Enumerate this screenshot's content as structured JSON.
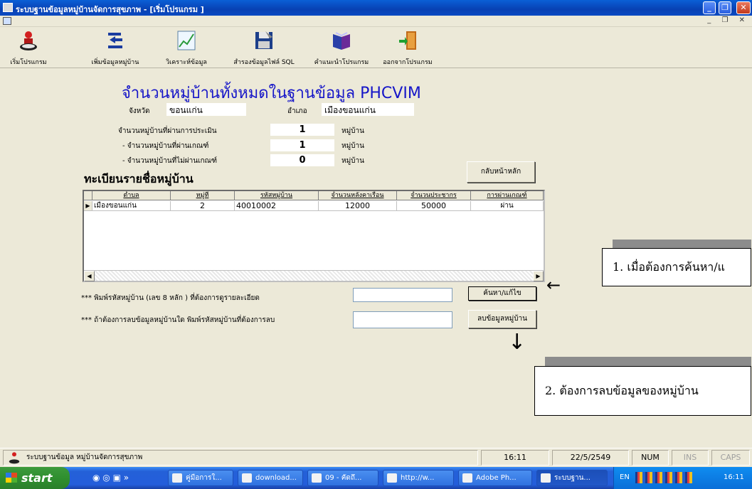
{
  "window": {
    "title": "ระบบฐานข้อมูลหมู่บ้านจัดการสุขภาพ - [เริ่มโปรแกรม ]",
    "min": "_",
    "max": "❐",
    "close": "✕",
    "mdi_controls": "_ ❐ ✕"
  },
  "toolbar": {
    "items": [
      {
        "label": "เริ่มโปรแกรม",
        "icon": "person-icon"
      },
      {
        "label": "เพิ่มข้อมูลหมู่บ้าน",
        "icon": "arrows-icon"
      },
      {
        "label": "วิเคราะห์ข้อมูล",
        "icon": "chart-icon"
      },
      {
        "label": "สำรองข้อมูลไฟล์ SQL",
        "icon": "floppy-icon"
      },
      {
        "label": "คำแนะนำโปรแกรม",
        "icon": "book-icon"
      },
      {
        "label": "ออกจากโปรแกรม",
        "icon": "exit-door-icon"
      }
    ]
  },
  "main": {
    "heading": "จำนวนหมู่บ้านทั้งหมดในฐานข้อมูล  PHCVIM",
    "province_label": "จังหวัด",
    "province_value": "ขอนแก่น",
    "district_label": "อำเภอ",
    "district_value": "เมืองขอนแก่น",
    "counts": [
      {
        "label": "จำนวนหมู่บ้านที่ผ่านการประเมิน",
        "value": "1",
        "unit": "หมู่บ้าน"
      },
      {
        "label": "- จำนวนหมู่บ้านที่ผ่านเกณฑ์",
        "value": "1",
        "unit": "หมู่บ้าน"
      },
      {
        "label": "- จำนวนหมู่บ้านที่ไม่ผ่านเกณฑ์",
        "value": "0",
        "unit": "หมู่บ้าน"
      }
    ],
    "back_button": "กลับหน้าหลัก",
    "register_heading": "ทะเบียนรายชื่อหมู่บ้าน",
    "grid": {
      "headers": [
        "ตำบล",
        "หมู่ที่",
        "รหัสหมู่บ้าน",
        "จำนวนหลังคาเรือน",
        "จำนวนประชากร",
        "การผ่านเกณฑ์"
      ],
      "rows": [
        [
          "เมืองขอนแก่น",
          "2",
          "40010002",
          "12000",
          "50000",
          "ผ่าน"
        ]
      ],
      "row_indicator": "▶",
      "scroll_left": "◀",
      "scroll_right": "▶"
    },
    "search_prompt": "*** พิมพ์รหัสหมู่บ้าน (เลข 8 หลัก ) ที่ต้องการดูรายละเอียด",
    "search_input": "",
    "search_button": "ค้นหา/แก้ไข",
    "delete_prompt": "*** ถ้าต้องการลบข้อมูลหมู่บ้านใด พิมพ์รหัสหมู่บ้านที่ต้องการลบ",
    "delete_input": "",
    "delete_button": "ลบข้อมูลหมู่บ้าน"
  },
  "annotations": {
    "callout1": "1. เมื่อต้องการค้นหา/แ",
    "callout2": "2.  ต้องการลบข้อมูลของหมู่บ้าน",
    "arrow_left": "←",
    "arrow_down": "↓"
  },
  "statusbar": {
    "app_name": "ระบบฐานข้อมูล หมู่บ้านจัดการสุขภาพ",
    "time": "16:11",
    "date": "22/5/2549",
    "num": "NUM",
    "ins": "INS",
    "caps": "CAPS"
  },
  "taskbar": {
    "start": "start",
    "items": [
      "คู่มือการใ...",
      "download...",
      "09 - คัดถึ...",
      "http://w...",
      "Adobe Ph...",
      "ระบบฐาน..."
    ],
    "tray_lang": "EN",
    "tray_time": "16:11"
  },
  "colors": {
    "heading": "#1515c8",
    "window_bg": "#ece9d8",
    "titlebar": "#0841b3",
    "taskbar": "#245edb",
    "start": "#2f8f2f"
  }
}
